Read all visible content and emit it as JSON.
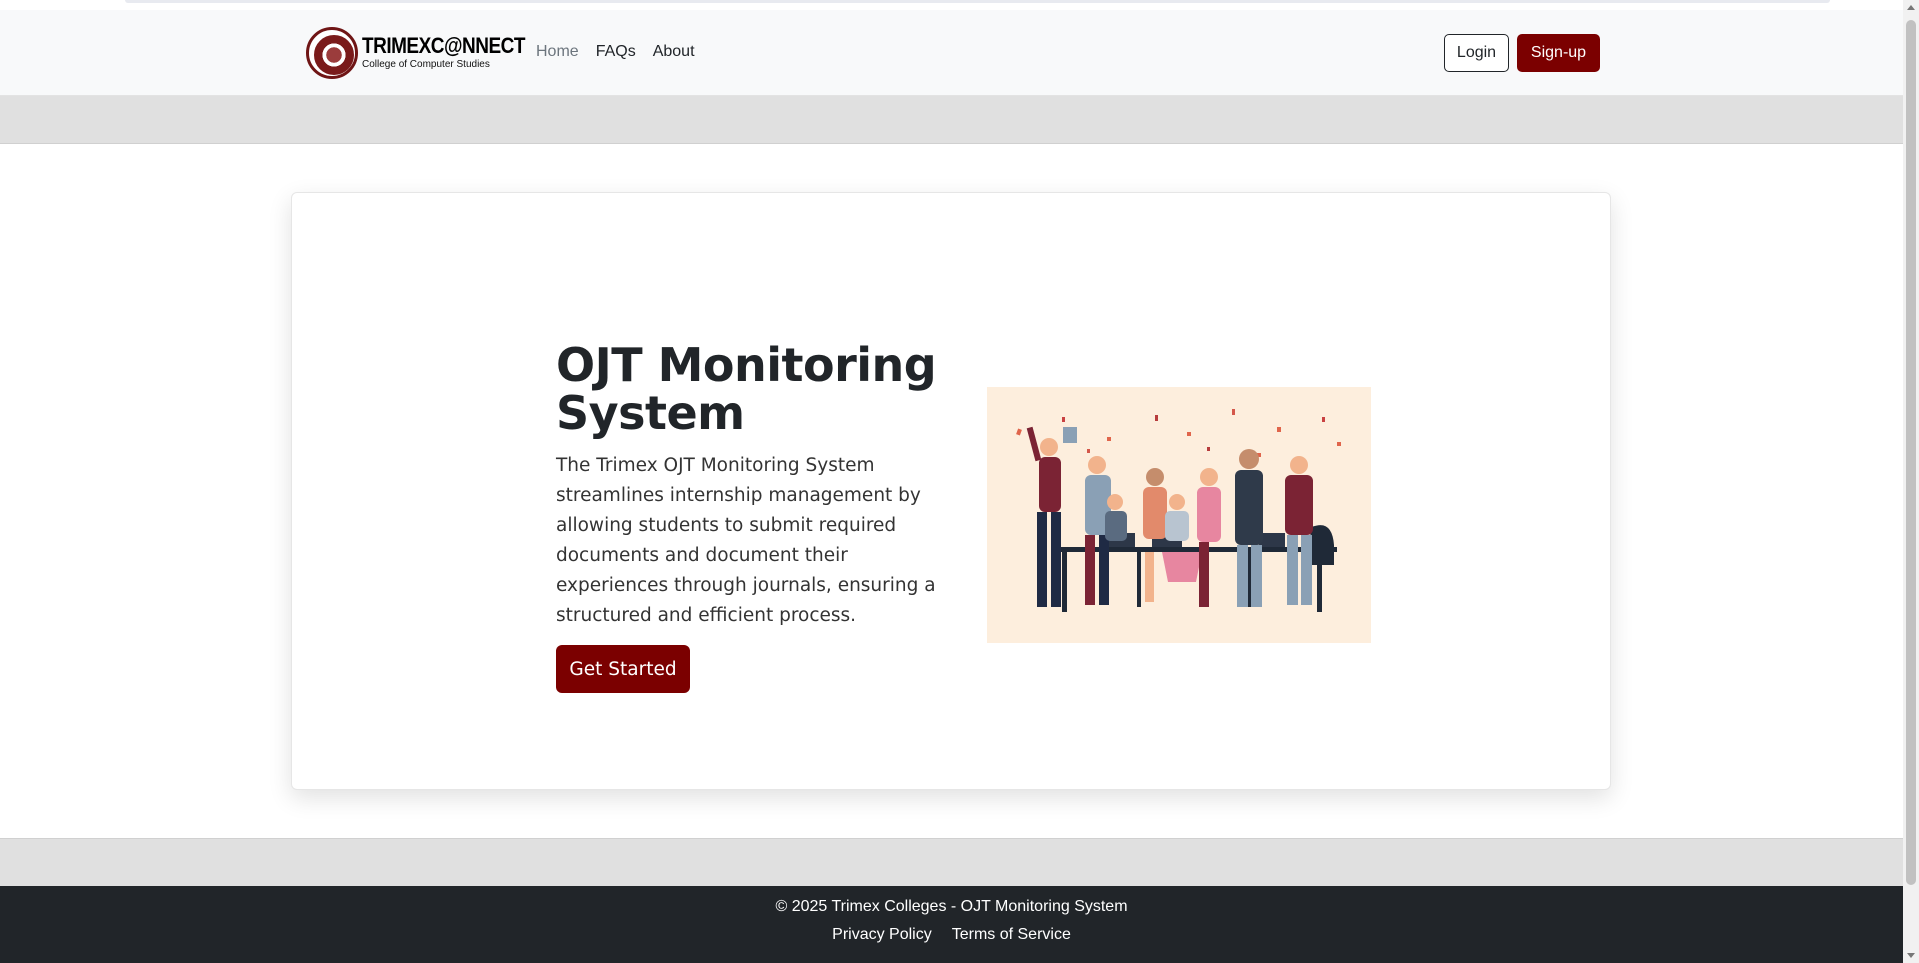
{
  "brand": {
    "title": "TRIMEXC@NNECT",
    "subtitle": "College of Computer Studies",
    "logo_icon": "college-seal-icon"
  },
  "nav": {
    "items": [
      {
        "label": "Home",
        "active": true
      },
      {
        "label": "FAQs",
        "active": false
      },
      {
        "label": "About",
        "active": false
      }
    ],
    "login_label": "Login",
    "signup_label": "Sign-up"
  },
  "hero": {
    "title": "OJT Monitoring System",
    "description": "The Trimex OJT Monitoring System streamlines internship management by allowing students to submit required documents and document their experiences through journals, ensuring a structured and efficient process.",
    "cta_label": "Get Started",
    "illustration": "celebrating-team-illustration"
  },
  "footer": {
    "copyright": "© 2025 Trimex Colleges - OJT Monitoring System",
    "links": [
      "Privacy Policy",
      "Terms of Service"
    ]
  },
  "colors": {
    "brand_primary": "#7b0000",
    "navbar_bg": "#f8f9fa",
    "footer_bg": "#212529",
    "band_gray": "#e0e0e0",
    "illustration_bg": "#fdeedd"
  }
}
